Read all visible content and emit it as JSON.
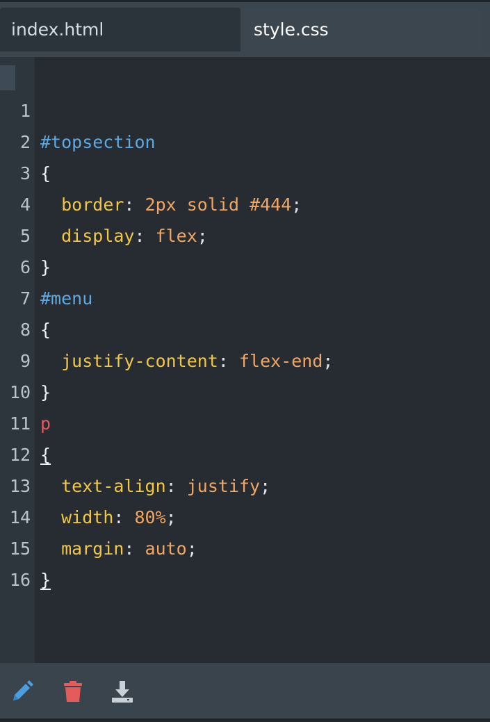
{
  "tabs": [
    {
      "label": "index.html",
      "active": false
    },
    {
      "label": "style.css",
      "active": true
    }
  ],
  "editor": {
    "line_numbers": [
      "1",
      "2",
      "3",
      "4",
      "5",
      "6",
      "7",
      "8",
      "9",
      "10",
      "11",
      "12",
      "13",
      "14",
      "15",
      "16"
    ],
    "lines": {
      "l1_selector": "#topsection",
      "l2_brace": "{",
      "l3_prop": "border",
      "l3_colon": ": ",
      "l3_value": "2px solid #444",
      "l3_semi": ";",
      "l4_prop": "display",
      "l4_colon": ": ",
      "l4_value": "flex",
      "l4_semi": ";",
      "l5_brace": "}",
      "l6_selector": "#menu",
      "l7_brace": "{",
      "l8_prop": "justify-content",
      "l8_colon": ": ",
      "l8_value": "flex-end",
      "l8_semi": ";",
      "l9_brace": "}",
      "l10_selector": "p",
      "l11_brace": "{",
      "l12_prop": "text-align",
      "l12_colon": ": ",
      "l12_value": "justify",
      "l12_semi": ";",
      "l13_prop": "width",
      "l13_colon": ": ",
      "l13_value": "80%",
      "l13_semi": ";",
      "l14_prop": "margin",
      "l14_colon": ": ",
      "l14_value": "auto",
      "l14_semi": ";",
      "l15_brace": "}"
    }
  },
  "toolbar": {
    "icons": [
      "pencil-icon",
      "trash-icon",
      "download-icon"
    ]
  },
  "colors": {
    "selector_id": "#5fa8e0",
    "selector_tag": "#e55a62",
    "property": "#f2c744",
    "value": "#f2a663",
    "edit_icon": "#4a9fe0",
    "delete_icon": "#e55a5a",
    "download_icon": "#c9d0d6"
  }
}
